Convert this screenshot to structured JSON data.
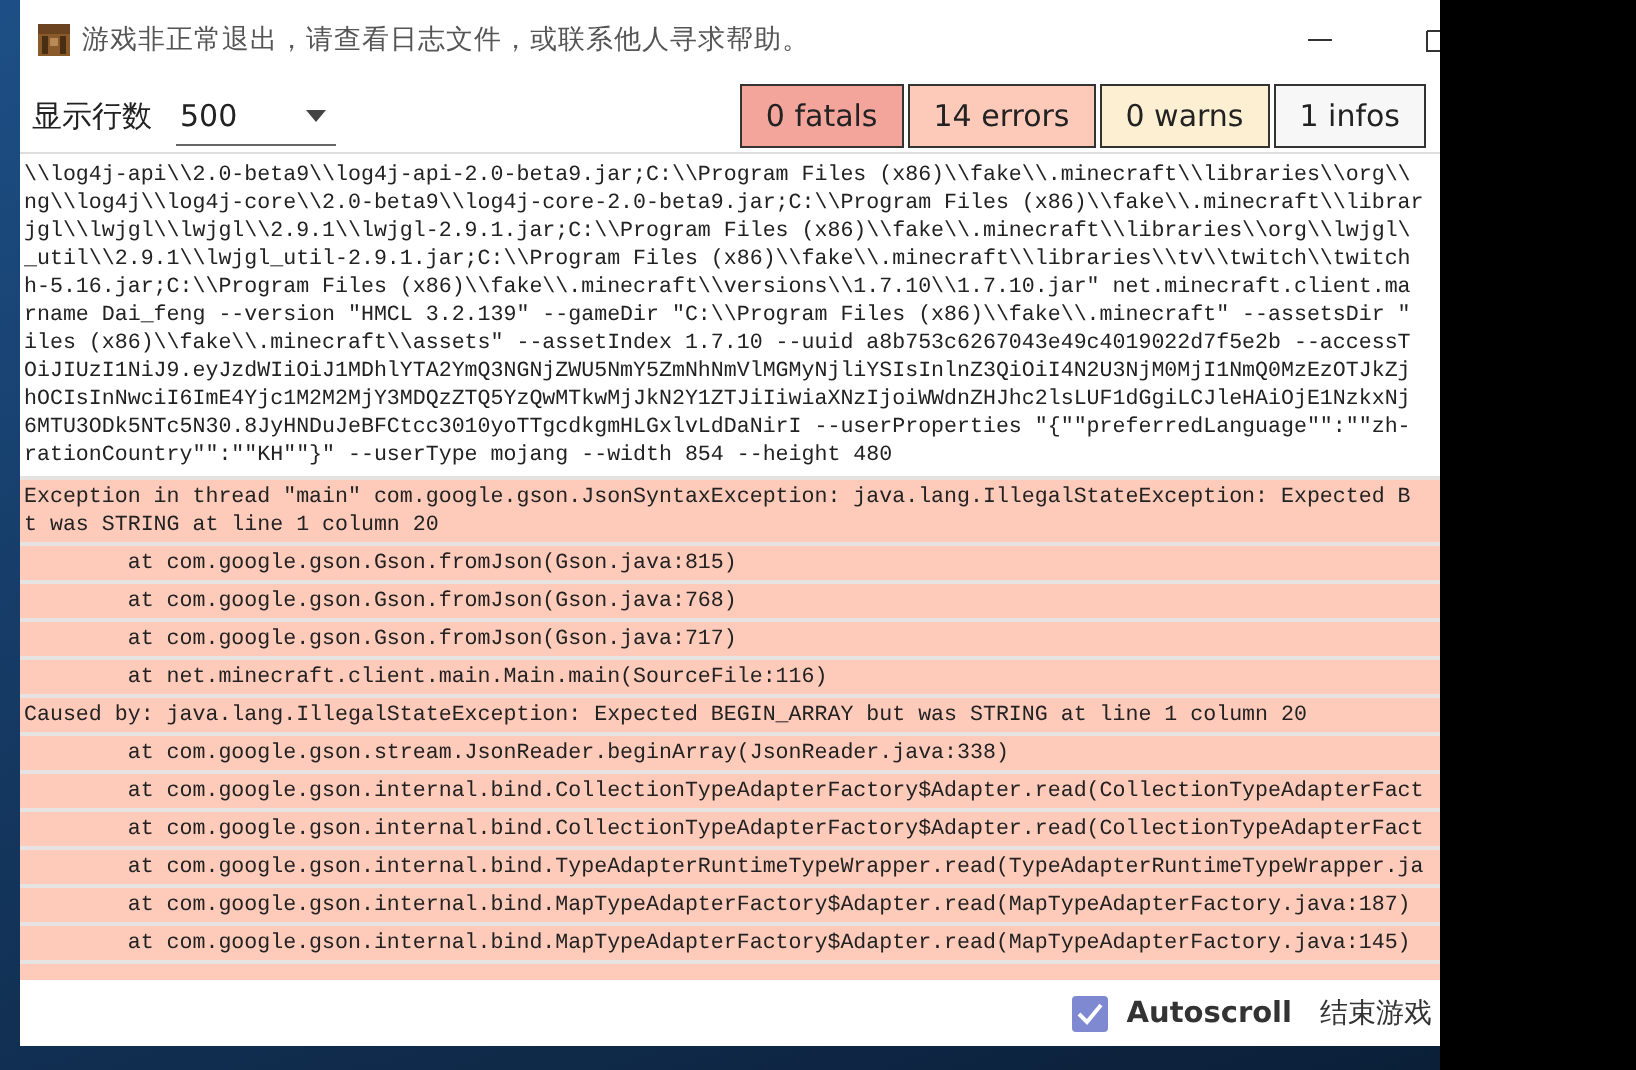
{
  "window": {
    "title": "游戏非正常退出，请查看日志文件，或联系他人寻求帮助。"
  },
  "toolbar": {
    "lines_label": "显示行数",
    "lines_value": "500",
    "filters": [
      {
        "kind": "fatal",
        "label": "0 fatals"
      },
      {
        "kind": "error",
        "label": "14 errors"
      },
      {
        "kind": "warn",
        "label": "0 warns"
      },
      {
        "kind": "info",
        "label": "1 infos"
      }
    ]
  },
  "log": [
    {
      "kind": "info",
      "lines": [
        "\\\\log4j-api\\\\2.0-beta9\\\\log4j-api-2.0-beta9.jar;C:\\\\Program Files (x86)\\\\fake\\\\.minecraft\\\\libraries\\\\org\\\\",
        "ng\\\\log4j\\\\log4j-core\\\\2.0-beta9\\\\log4j-core-2.0-beta9.jar;C:\\\\Program Files (x86)\\\\fake\\\\.minecraft\\\\librar",
        "jgl\\\\lwjgl\\\\lwjgl\\\\2.9.1\\\\lwjgl-2.9.1.jar;C:\\\\Program Files (x86)\\\\fake\\\\.minecraft\\\\libraries\\\\org\\\\lwjgl\\",
        "_util\\\\2.9.1\\\\lwjgl_util-2.9.1.jar;C:\\\\Program Files (x86)\\\\fake\\\\.minecraft\\\\libraries\\\\tv\\\\twitch\\\\twitch",
        "h-5.16.jar;C:\\\\Program Files (x86)\\\\fake\\\\.minecraft\\\\versions\\\\1.7.10\\\\1.7.10.jar\" net.minecraft.client.ma",
        "rname Dai_feng --version \"HMCL 3.2.139\" --gameDir \"C:\\\\Program Files (x86)\\\\fake\\\\.minecraft\" --assetsDir \"",
        "iles (x86)\\\\fake\\\\.minecraft\\\\assets\" --assetIndex 1.7.10 --uuid a8b753c6267043e49c4019022d7f5e2b --accessT",
        "OiJIUzI1NiJ9.eyJzdWIiOiJ1MDhlYTA2YmQ3NGNjZWU5NmY5ZmNhNmVlMGMyNjliYSIsInlnZ3QiOiI4N2U3NjM0MjI1NmQ0MzEzOTJkZj",
        "hOCIsInNwciI6ImE4Yjc1M2M2MjY3MDQzZTQ5YzQwMTkwMjJkN2Y1ZTJiIiwiaXNzIjoiWWdnZHJhc2lsLUF1dGgiLCJleHAiOjE1NzkxNj",
        "6MTU3ODk5NTc5N30.8JyHNDuJeBFCtcc3010yoTTgcdkgmHLGxlvLdDaNirI --userProperties \"{\"\"preferredLanguage\"\":\"\"zh-",
        "rationCountry\"\":\"\"KH\"\"}\" --userType mojang --width 854 --height 480"
      ]
    },
    {
      "kind": "error",
      "lines": [
        "Exception in thread \"main\" com.google.gson.JsonSyntaxException: java.lang.IllegalStateException: Expected B",
        "t was STRING at line 1 column 20"
      ]
    },
    {
      "kind": "error",
      "lines": [
        "\tat com.google.gson.Gson.fromJson(Gson.java:815)"
      ]
    },
    {
      "kind": "error",
      "lines": [
        "\tat com.google.gson.Gson.fromJson(Gson.java:768)"
      ]
    },
    {
      "kind": "error",
      "lines": [
        "\tat com.google.gson.Gson.fromJson(Gson.java:717)"
      ]
    },
    {
      "kind": "error",
      "lines": [
        "\tat net.minecraft.client.main.Main.main(SourceFile:116)"
      ]
    },
    {
      "kind": "error",
      "lines": [
        "Caused by: java.lang.IllegalStateException: Expected BEGIN_ARRAY but was STRING at line 1 column 20"
      ]
    },
    {
      "kind": "error",
      "lines": [
        "\tat com.google.gson.stream.JsonReader.beginArray(JsonReader.java:338)"
      ]
    },
    {
      "kind": "error",
      "lines": [
        "\tat com.google.gson.internal.bind.CollectionTypeAdapterFactory$Adapter.read(CollectionTypeAdapterFact"
      ]
    },
    {
      "kind": "error",
      "lines": [
        "\tat com.google.gson.internal.bind.CollectionTypeAdapterFactory$Adapter.read(CollectionTypeAdapterFact"
      ]
    },
    {
      "kind": "error",
      "lines": [
        "\tat com.google.gson.internal.bind.TypeAdapterRuntimeTypeWrapper.read(TypeAdapterRuntimeTypeWrapper.ja"
      ]
    },
    {
      "kind": "error",
      "lines": [
        "\tat com.google.gson.internal.bind.MapTypeAdapterFactory$Adapter.read(MapTypeAdapterFactory.java:187)"
      ]
    },
    {
      "kind": "error",
      "lines": [
        "\tat com.google.gson.internal.bind.MapTypeAdapterFactory$Adapter.read(MapTypeAdapterFactory.java:145)"
      ]
    }
  ],
  "footer": {
    "autoscroll": {
      "label": "Autoscroll",
      "checked": true
    },
    "end_button": "结束游戏"
  }
}
